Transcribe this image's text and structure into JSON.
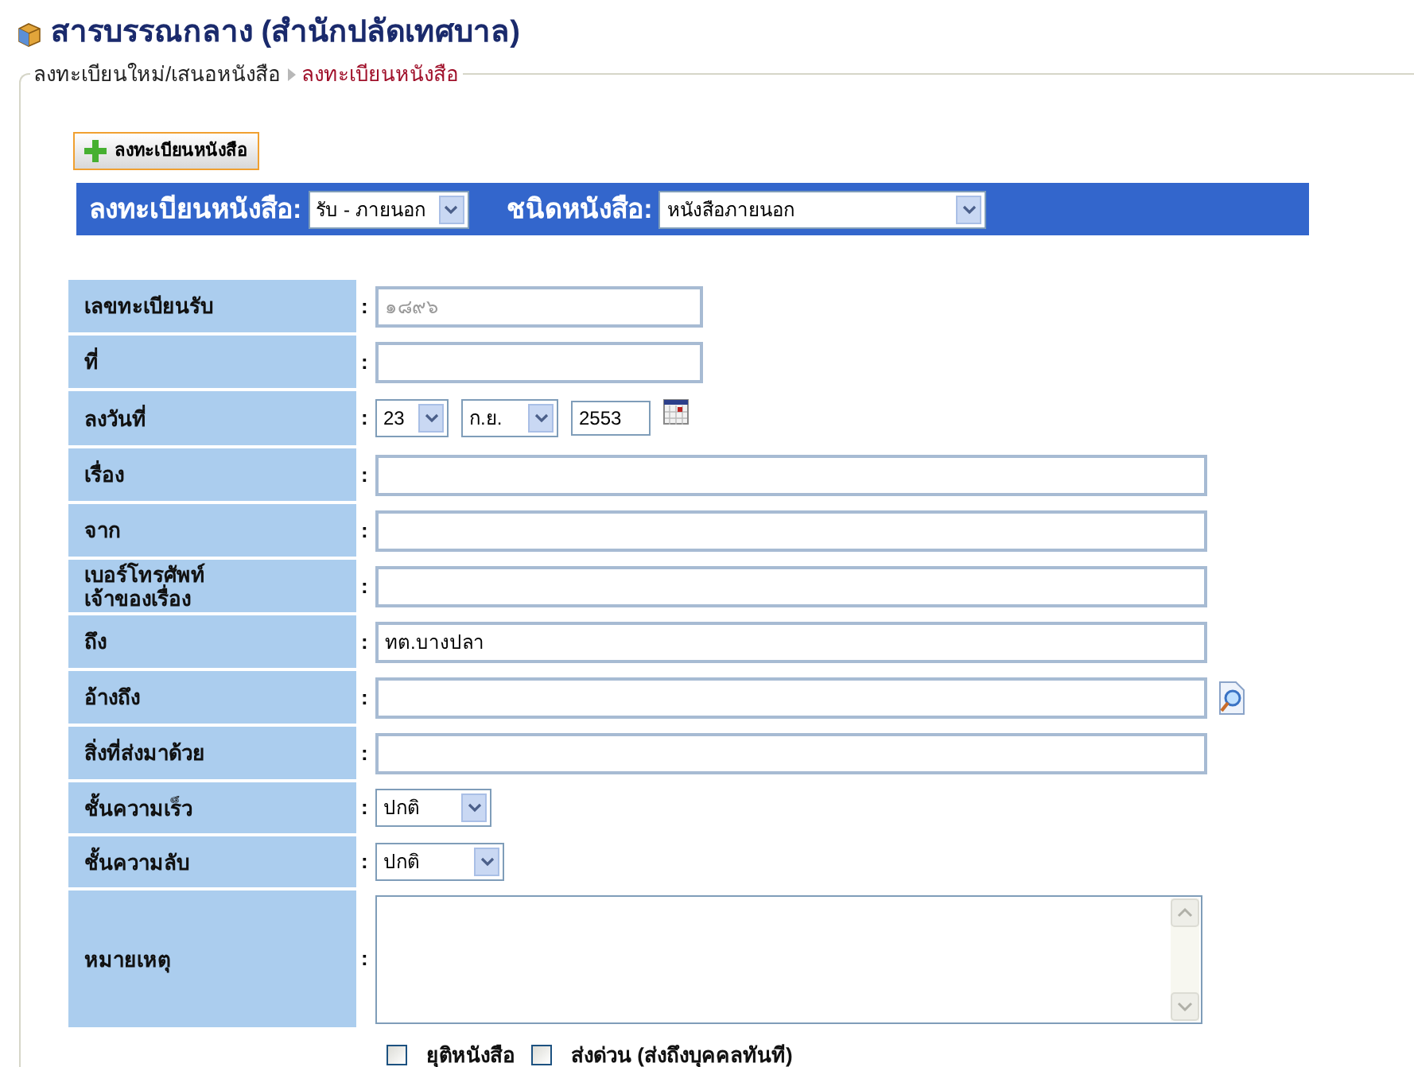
{
  "page_title": "สารบรรณกลาง (สำนักปลัดเทศบาล)",
  "breadcrumb": [
    {
      "label": "ลงทะเบียนใหม่/เสนอหนังสือ",
      "selected": false
    },
    {
      "label": "ลงทะเบียนหนังสือ",
      "selected": true
    }
  ],
  "register_button": "ลงทะเบียนหนังสือ",
  "filter_bar": {
    "register_label": "ลงทะเบียนหนังสือ:",
    "register_value": "รับ - ภายนอก",
    "type_label": "ชนิดหนังสือ:",
    "type_value": "หนังสือภายนอก"
  },
  "fields": [
    {
      "label": "เลขทะเบียนรับ",
      "kind": "readonly",
      "value": "๑๘๙๖"
    },
    {
      "label": "ที่",
      "kind": "short_text"
    },
    {
      "label": "ลงวันที่",
      "kind": "date",
      "day": "23",
      "month": "ก.ย.",
      "year": "2553"
    },
    {
      "label": "เรื่อง",
      "kind": "text"
    },
    {
      "label": "จาก",
      "kind": "text"
    },
    {
      "label": "เบอร์โทรศัพท์\nเจ้าของเรื่อง",
      "kind": "text"
    },
    {
      "label": "ถึง",
      "kind": "text",
      "value": "ทต.บางปลา"
    },
    {
      "label": "อ้างถึง",
      "kind": "lookup"
    },
    {
      "label": "สิ่งที่ส่งมาด้วย",
      "kind": "text"
    },
    {
      "label": "ชั้นความเร็ว",
      "kind": "select",
      "value": "ปกติ"
    },
    {
      "label": "ชั้นความลับ",
      "kind": "select",
      "value": "ปกติ"
    },
    {
      "label": "หมายเหตุ",
      "kind": "textarea"
    }
  ],
  "colon": ":",
  "options": [
    {
      "label": "ยุติหนังสือ",
      "checked": false
    },
    {
      "label": "ส่งด่วน (ส่งถึงบุคคลทันที)",
      "checked": false
    }
  ]
}
